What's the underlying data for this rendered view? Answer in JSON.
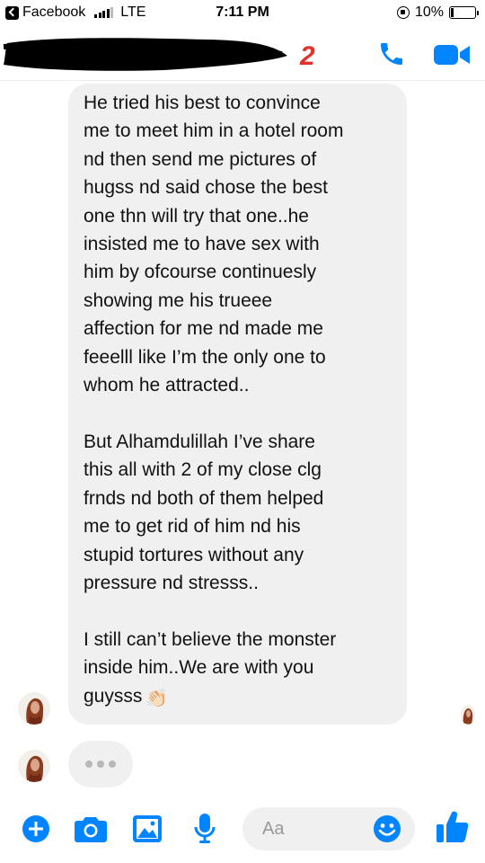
{
  "status_bar": {
    "back_app": "Facebook",
    "network": "LTE",
    "time": "7:11 PM",
    "battery": "10%",
    "battery_level": 0.1
  },
  "header": {
    "annotation": "2",
    "accent_color": "#0084ff",
    "annotation_color": "#e0312b"
  },
  "message": {
    "paragraphs": [
      [
        "He tried his best to convince",
        "me to meet him in a hotel room",
        "nd then send me pictures of",
        "hugss nd said chose the best",
        "one thn will try that one..he",
        "insisted me to have sex with",
        "him by ofcourse continuesly",
        "showing me his trueee",
        "affection for me nd made me",
        "feeelll like I’m the only one to",
        "whom he attracted.."
      ],
      [
        "But Alhamdulillah I’ve share",
        "this all with 2 of my close clg",
        "frnds nd both of them helped",
        "me to get rid of him nd his",
        "stupid tortures without any",
        "pressure nd stresss.."
      ],
      [
        "I still can’t believe the monster",
        "inside him..We are with you",
        "guysss"
      ]
    ],
    "emoji": "👏🏻"
  },
  "composer": {
    "placeholder": "Aa",
    "icons": [
      "plus-icon",
      "camera-icon",
      "image-icon",
      "microphone-icon",
      "emoji-icon",
      "thumbs-up-icon"
    ]
  }
}
